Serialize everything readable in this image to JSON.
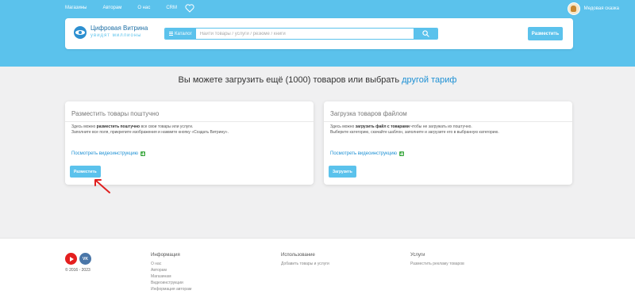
{
  "topnav": {
    "links": [
      "Магазины",
      "Авторам",
      "О нас",
      "CRM"
    ],
    "user_name": "Медовая сказка"
  },
  "header": {
    "logo_title": "Цифровая Витрина",
    "logo_tagline": "увидят миллионы",
    "catalog_label": "Каталог",
    "search_placeholder": "Найти товары / услуги / резюме / книги",
    "post_button": "Разместить"
  },
  "info": {
    "text": "Вы можете загрузить ещё (1000) товаров или выбрать",
    "link": "другой тариф"
  },
  "cards": [
    {
      "title": "Разместить товары поштучно",
      "desc_pre": "Здесь можно ",
      "desc_bold": "разместить поштучно",
      "desc_post": " все свои товары или услуги.",
      "desc_line2": "Заполните все поля, прикрепите изображения и нажмите кнопку «Создать Витрину».",
      "video_link": "Посмотреть видеоинструкцию",
      "button": "Разместить"
    },
    {
      "title": "Загрузка товаров файлом",
      "desc_pre": "Здесь можно ",
      "desc_bold": "загрузить файл с товарами",
      "desc_post": " чтобы не загружать их поштучно.",
      "desc_line2": "Выберите категорию, скачайте шаблон, заполните и загрузите его в выбранную категорию.",
      "video_link": "Посмотреть видеоинструкцию",
      "button": "Загрузить"
    }
  ],
  "footer": {
    "copyright": "© 2016 - 2023",
    "vk_label": "VK",
    "columns": [
      {
        "title": "Информация",
        "items": [
          "О нас",
          "Авторам",
          "Магазинам",
          "Видеоинструкции",
          "Информация авторам"
        ]
      },
      {
        "title": "Использование",
        "items": [
          "Добавить товары и услуги"
        ]
      },
      {
        "title": "Услуги",
        "items": [
          "Разместить рекламу товаров"
        ]
      }
    ]
  },
  "colors": {
    "accent": "#5bc2ec",
    "link": "#1d90d4",
    "annotation_arrow": "#e02020"
  }
}
